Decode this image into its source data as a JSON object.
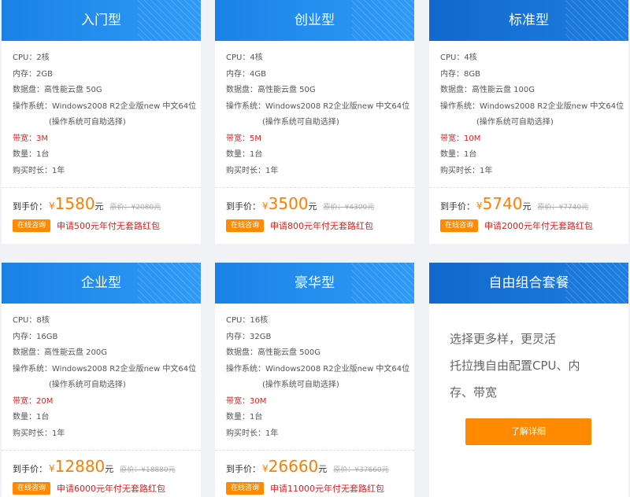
{
  "labels": {
    "cpu": "CPU：",
    "mem": "内存：",
    "disk": "数据盘：",
    "os": "操作系统：",
    "bw": "带宽：",
    "qty": "数量：",
    "duration": "购买时长：",
    "price": "到手价：",
    "currency": "¥",
    "unit": "元",
    "orig_prefix": "原价：",
    "consult": "在线咨询"
  },
  "plans": [
    {
      "title": "入门型",
      "cpu": "2核",
      "mem": "2GB",
      "disk": "高性能云盘 50G",
      "os": "Windows2008 R2企业版new 中文64位",
      "os_note": "(操作系统可自助选择)",
      "bw": "3M",
      "qty": "1台",
      "duration": "1年",
      "price": "1580",
      "orig": "¥2080元",
      "promo": "申请500元年付无套路红包"
    },
    {
      "title": "创业型",
      "cpu": "4核",
      "mem": "4GB",
      "disk": "高性能云盘 50G",
      "os": "Windows2008 R2企业版new 中文64位",
      "os_note": "(操作系统可自助选择)",
      "bw": "5M",
      "qty": "1台",
      "duration": "1年",
      "price": "3500",
      "orig": "¥4300元",
      "promo": "申请800元年付无套路红包"
    },
    {
      "title": "标准型",
      "cpu": "4核",
      "mem": "8GB",
      "disk": "高性能云盘 100G",
      "os": "Windows2008 R2企业版new 中文64位",
      "os_note": "(操作系统可自助选择)",
      "bw": "10M",
      "qty": "1台",
      "duration": "1年",
      "price": "5740",
      "orig": "¥7740元",
      "promo": "申请2000元年付无套路红包"
    },
    {
      "title": "企业型",
      "cpu": "8核",
      "mem": "16GB",
      "disk": "高性能云盘 200G",
      "os": "Windows2008 R2企业版new 中文64位",
      "os_note": "(操作系统可自助选择)",
      "bw": "20M",
      "qty": "1台",
      "duration": "1年",
      "price": "12880",
      "orig": "¥18880元",
      "promo": "申请6000元年付无套路红包"
    },
    {
      "title": "豪华型",
      "cpu": "16核",
      "mem": "32GB",
      "disk": "高性能云盘 500G",
      "os": "Windows2008 R2企业版new 中文64位",
      "os_note": "(操作系统可自助选择)",
      "bw": "30M",
      "qty": "1台",
      "duration": "1年",
      "price": "26660",
      "orig": "¥37660元",
      "promo": "申请11000元年付无套路红包"
    }
  ],
  "custom": {
    "title": "自由组合套餐",
    "line1": "选择更多样，更灵活",
    "line2": "托拉拽自由配置CPU、内",
    "line3": "存、带宽",
    "button": "了解详细"
  },
  "colors": {
    "header_blue": "#1a82e6",
    "accent_orange": "#ff8a00",
    "price_orange": "#ff7e00",
    "alert_red": "#e02020"
  }
}
